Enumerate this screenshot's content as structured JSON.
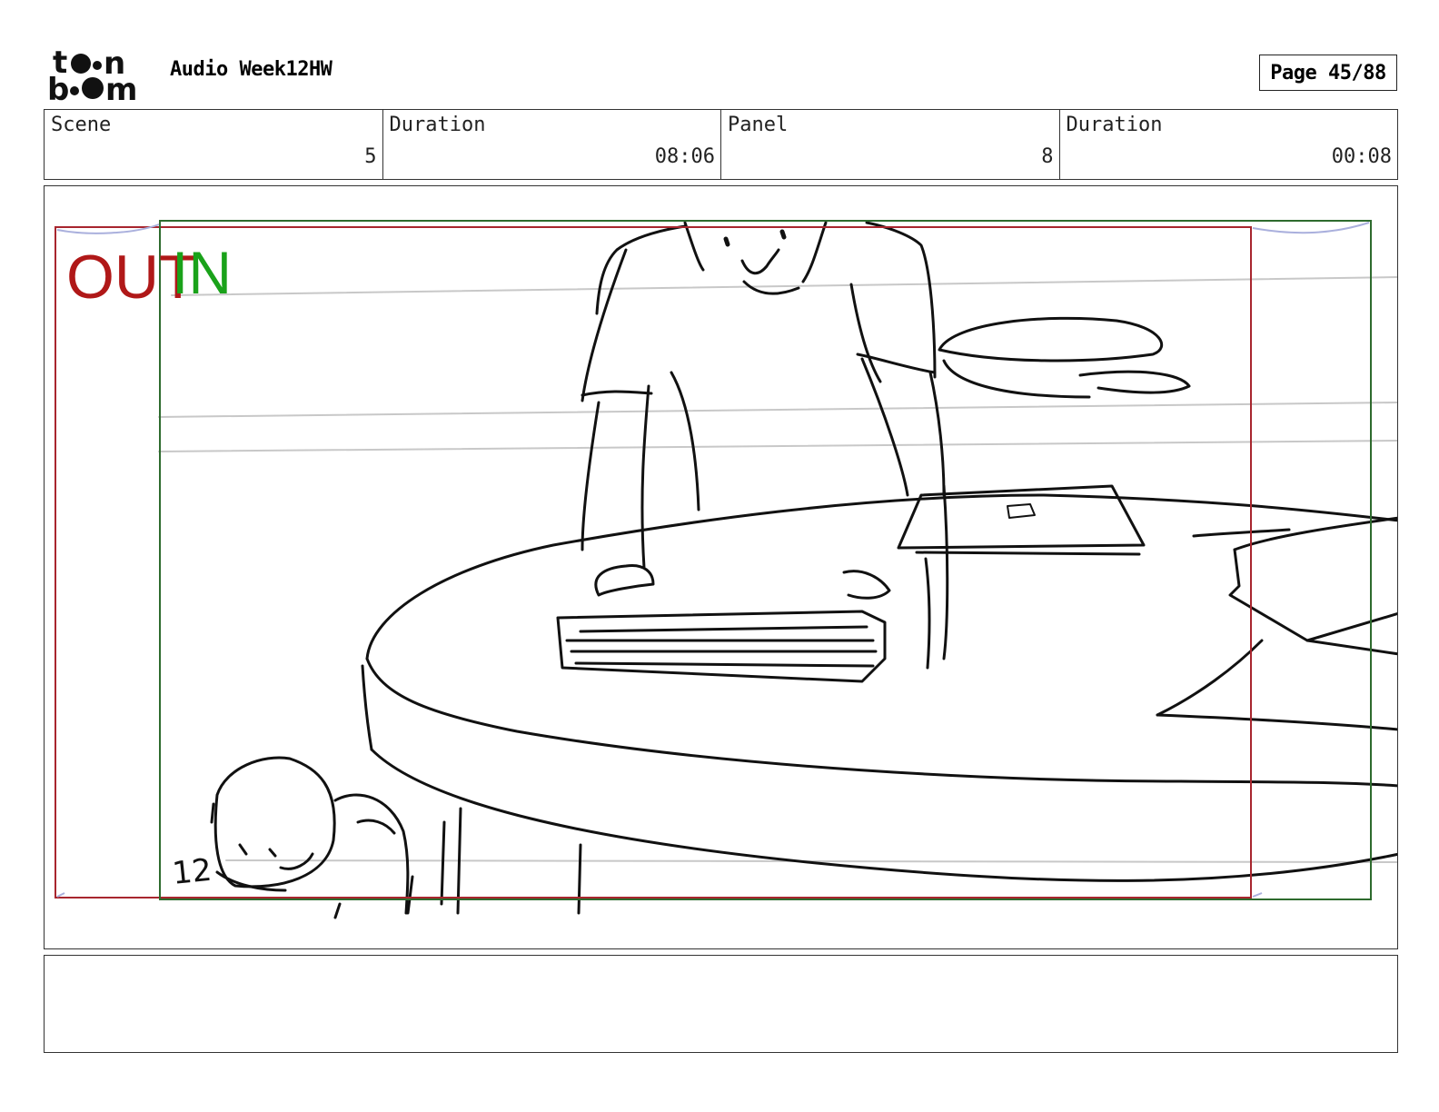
{
  "header": {
    "logo_text": "toon boom",
    "title": "Audio Week12HW",
    "page_label": "Page 45/88"
  },
  "info": {
    "scene": {
      "label": "Scene",
      "value": "5"
    },
    "scene_duration": {
      "label": "Duration",
      "value": "08:06"
    },
    "panel": {
      "label": "Panel",
      "value": "8"
    },
    "panel_duration": {
      "label": "Duration",
      "value": "00:08"
    }
  },
  "panel_image": {
    "out_label": "OUT",
    "in_label": "IN",
    "sketch_number": "12",
    "colors": {
      "out": "#b01818",
      "in": "#1aa21a",
      "frame_red": "#a8262e",
      "frame_green": "#2e6b2e"
    }
  },
  "notes": {
    "text": ""
  }
}
